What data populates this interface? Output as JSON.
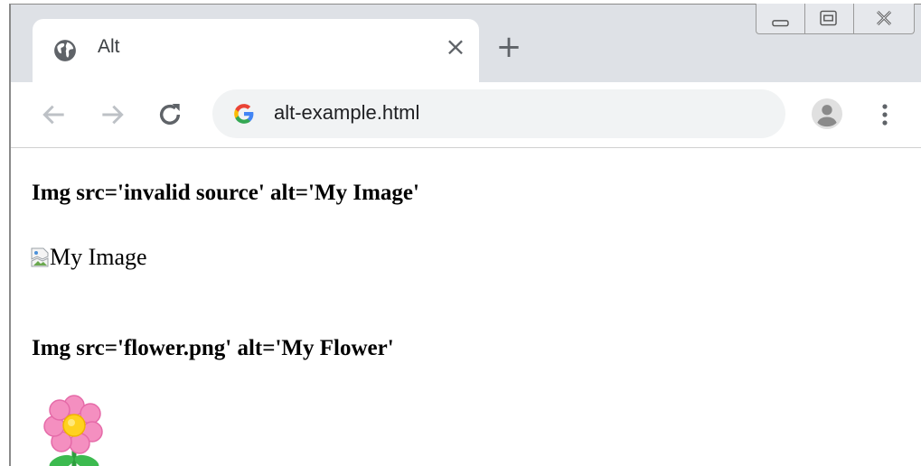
{
  "tab": {
    "title": "Alt",
    "close_glyph": "×",
    "favicon": "globe-icon"
  },
  "new_tab_glyph": "+",
  "window_controls": [
    "minimize-icon",
    "restore-icon",
    "close-icon"
  ],
  "toolbar": {
    "url": "alt-example.html",
    "search_engine_icon": "google-g-icon",
    "icons": [
      "back-arrow-icon",
      "forward-arrow-icon",
      "reload-icon",
      "profile-avatar-icon",
      "more-vert-icon"
    ]
  },
  "page": {
    "heading1": "Img src='invalid source' alt='My Image'",
    "broken_image_alt": "My Image",
    "heading2": "Img src='flower.png' alt='My Flower'",
    "flower_icon": "flower-icon"
  },
  "colors": {
    "tabstrip": "#dee1e6",
    "omnibox": "#f1f3f4",
    "icon_gray": "#5f6368"
  }
}
